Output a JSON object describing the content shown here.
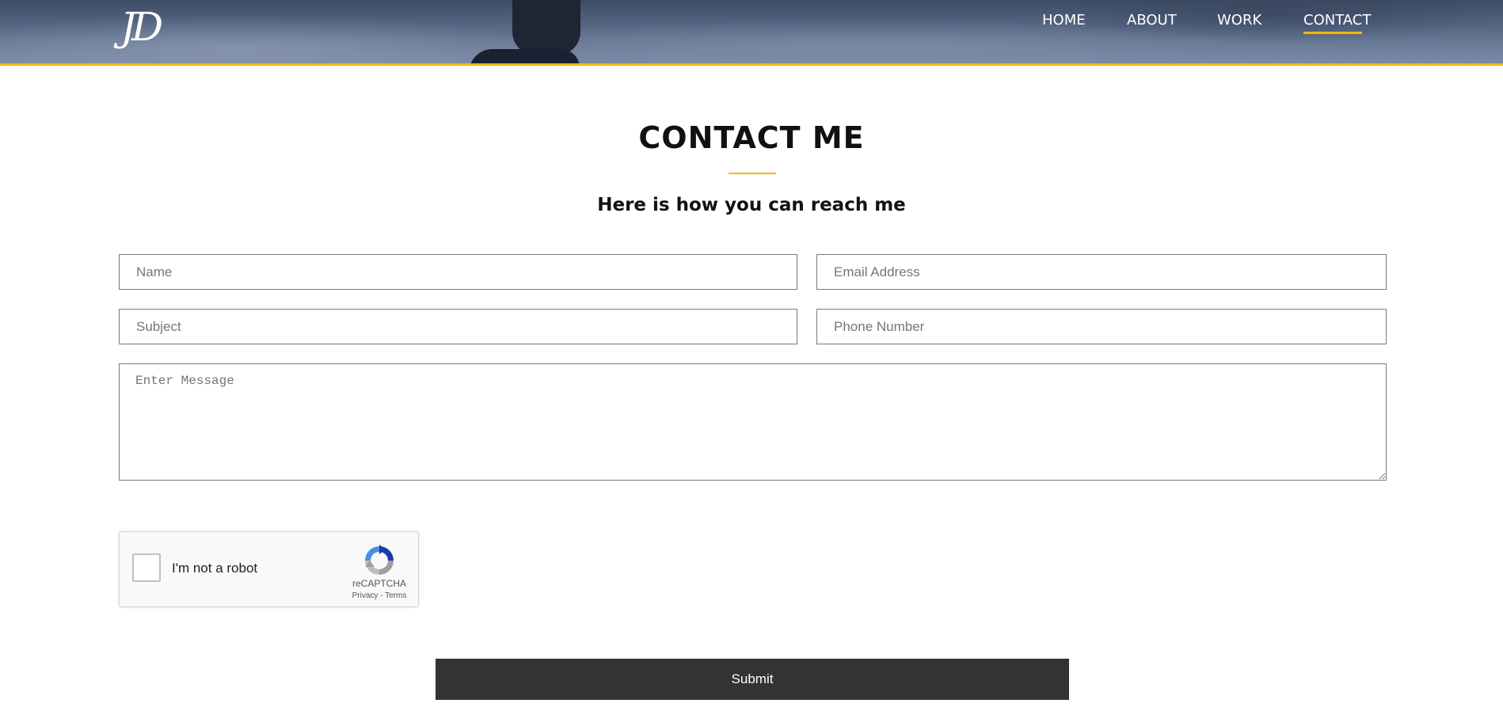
{
  "header": {
    "logo_text": "JD",
    "nav": [
      "HOME",
      "ABOUT",
      "WORK",
      "CONTACT"
    ],
    "active_nav": "CONTACT",
    "accent_color": "#f5b800"
  },
  "main": {
    "title": "CONTACT ME",
    "subtitle": "Here is how you can reach me"
  },
  "form": {
    "name_placeholder": "Name",
    "email_placeholder": "Email Address",
    "subject_placeholder": "Subject",
    "phone_placeholder": "Phone Number",
    "message_placeholder": "Enter Message",
    "submit_label": "Submit"
  },
  "captcha": {
    "label": "I'm not a robot",
    "brand": "reCAPTCHA",
    "privacy": "Privacy",
    "separator": " - ",
    "terms": "Terms"
  }
}
